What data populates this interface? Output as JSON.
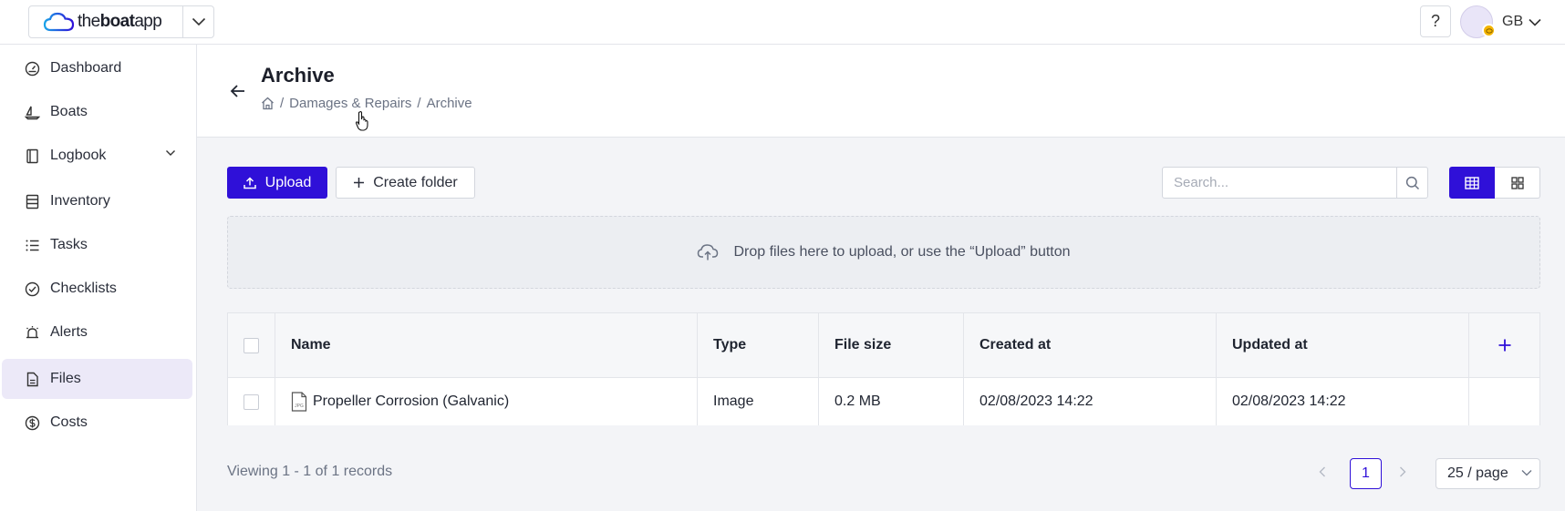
{
  "brand": {
    "name_light": "the",
    "name_bold": "boat",
    "name_suffix": "app"
  },
  "topbar": {
    "help_label": "?",
    "user_initials": "GB"
  },
  "sidebar": {
    "items": [
      {
        "label": "Dashboard",
        "icon": "gauge-icon"
      },
      {
        "label": "Boats",
        "icon": "sailboat-icon"
      },
      {
        "label": "Logbook",
        "icon": "book-icon"
      },
      {
        "label": "Inventory",
        "icon": "inventory-icon"
      },
      {
        "label": "Tasks",
        "icon": "list-icon"
      },
      {
        "label": "Checklists",
        "icon": "check-circle-icon"
      },
      {
        "label": "Alerts",
        "icon": "alarm-icon"
      },
      {
        "label": "Files",
        "icon": "file-icon",
        "active": true
      },
      {
        "label": "Costs",
        "icon": "dollar-circle-icon"
      }
    ]
  },
  "header": {
    "title": "Archive",
    "breadcrumb": [
      {
        "label": "Damages & Repairs"
      },
      {
        "label": "Archive"
      }
    ],
    "separator": "/"
  },
  "toolbar": {
    "upload_label": "Upload",
    "create_folder_label": "Create folder",
    "search_placeholder": "Search..."
  },
  "dropzone": {
    "text": "Drop files here to upload, or use the “Upload” button"
  },
  "table": {
    "columns": [
      "Name",
      "Type",
      "File size",
      "Created at",
      "Updated at"
    ],
    "add_column_label": "+",
    "rows": [
      {
        "name": "Propeller Corrosion (Galvanic)",
        "file_type_badge": "JPG",
        "type": "Image",
        "file_size": "0.2 MB",
        "created_at": "02/08/2023 14:22",
        "updated_at": "02/08/2023 14:22"
      }
    ]
  },
  "footer": {
    "records_text": "Viewing 1 - 1 of 1 records",
    "current_page": "1",
    "page_size": "25 / page"
  },
  "colors": {
    "accent": "#2f10d8",
    "active_nav_bg": "#ece9f8",
    "page_bg": "#f3f4f7"
  }
}
